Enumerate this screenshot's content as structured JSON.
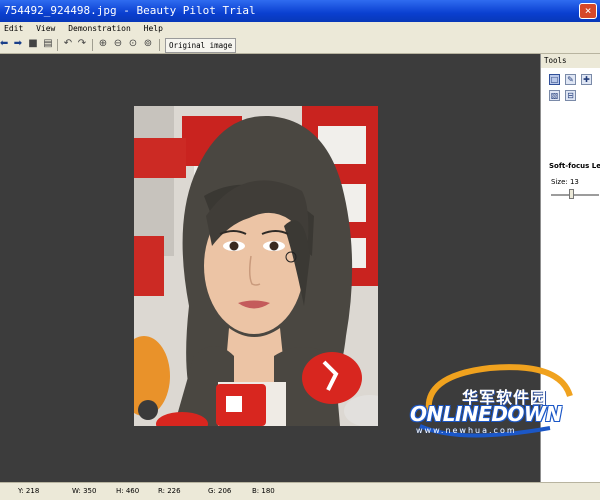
{
  "window": {
    "title": "754492_924498.jpg - Beauty Pilot Trial",
    "close_symbol": "×"
  },
  "menu": {
    "items": [
      "Edit",
      "View",
      "Demonstration",
      "Help"
    ]
  },
  "toolbar": {
    "icons": [
      {
        "name": "back-arrow-icon",
        "glyph": "➡"
      },
      {
        "name": "forward-arrow-icon",
        "glyph": "➡"
      },
      {
        "name": "save-icon",
        "glyph": "■"
      },
      {
        "name": "print-icon",
        "glyph": "▤"
      },
      {
        "name": "undo-icon",
        "glyph": "↶"
      },
      {
        "name": "redo-icon",
        "glyph": "↷"
      },
      {
        "name": "zoom-in-icon",
        "glyph": "⊕"
      },
      {
        "name": "zoom-out-icon",
        "glyph": "⊖"
      },
      {
        "name": "zoom-fit-icon",
        "glyph": "⊙"
      },
      {
        "name": "zoom-actual-icon",
        "glyph": "⊚"
      }
    ],
    "original_image_label": "Original image"
  },
  "tools_panel": {
    "header": "Tools",
    "section_title": "Soft-focus Le",
    "size_label": "Size: 13"
  },
  "status": {
    "y": "Y: 218",
    "w": "W: 350",
    "h": "H: 460",
    "r": "R: 226",
    "g": "G: 206",
    "b": "B: 180"
  },
  "watermark": {
    "cn": "华军软件园",
    "en": "ONLINEDOWN",
    "url": "www.newhua.com"
  },
  "colors": {
    "titlebar": "#0a3fd0",
    "canvas": "#3c3c3c",
    "chrome": "#ece9d8",
    "watermark_blue": "#1b57c7",
    "watermark_orange": "#f0a21e"
  }
}
